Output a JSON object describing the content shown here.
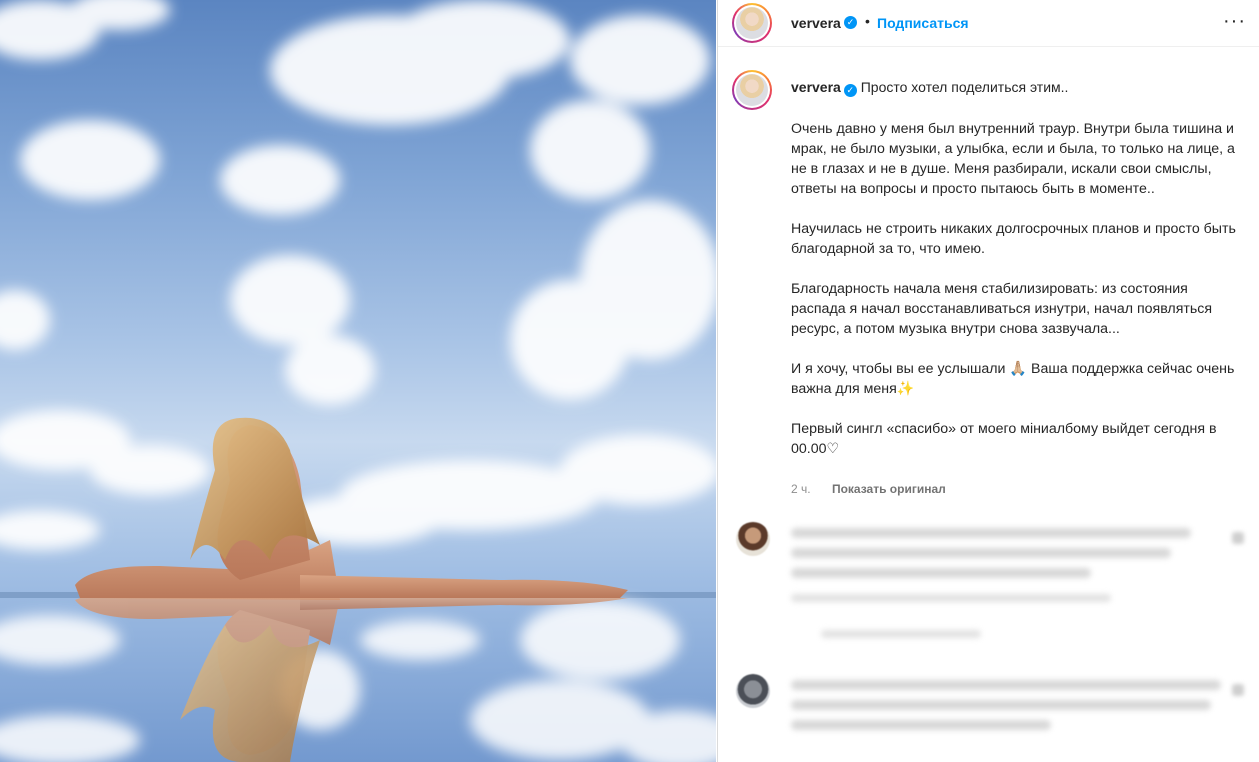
{
  "post": {
    "username": "ververa",
    "verified_mark": "✓",
    "separator": "•",
    "follow_label": "Подписаться",
    "more_label": "···"
  },
  "caption": {
    "username": "ververa",
    "first_line": "Просто хотел поделиться этим..",
    "paragraphs": [
      "Очень давно у меня был внутренний траур. Внутри была тишина и мрак, не было музыки, а улыбка, если и была, то только на лице, а не в глазах и не в душе. Меня разбирали, искали свои смыслы, ответы на вопросы и просто пытаюсь быть в моменте..",
      "Научилась не строить никаких долгосрочных планов и просто быть благодарной за то, что имею.",
      "Благодарность начала меня стабилизировать: из состояния распада я начал восстанавливаться изнутри, начал появляться ресурс, а потом музыка внутри снова зазвучала...",
      "И я хочу, чтобы вы ее услышали 🙏🏼 Ваша поддержка сейчас очень важна для меня✨",
      "Первый сингл «спасибо» от моего міниалбому выйдет сегодня в 00.00♡"
    ],
    "time": "2 ч.",
    "show_original": "Показать оригинал"
  },
  "icons": {
    "verified": "verified-badge-icon",
    "more": "more-options-icon"
  },
  "colors": {
    "accent": "#0095f6",
    "text": "#262626",
    "muted": "#8e8e8e"
  }
}
